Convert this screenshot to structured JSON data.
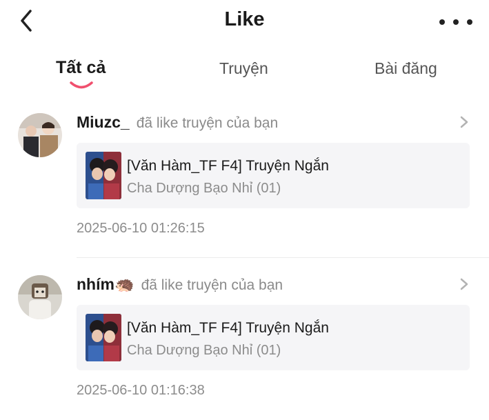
{
  "header": {
    "title": "Like",
    "back_icon": "chevron-left-icon",
    "more_icon": "more-horizontal-icon"
  },
  "tabs": [
    {
      "label": "Tất cả",
      "active": true
    },
    {
      "label": "Truyện",
      "active": false
    },
    {
      "label": "Bài đăng",
      "active": false
    }
  ],
  "colors": {
    "accent": "#f0506e",
    "card_bg": "#f5f5f7",
    "muted_text": "#8c8c8c"
  },
  "notifications": [
    {
      "username": "Miuzc_",
      "action": "đã like truyện của bạn",
      "story_title": "[Văn Hàm_TF F4] Truyện Ngắn",
      "chapter": "Cha Dượng Bạo Nhỉ (01)",
      "time": "2025-06-10 01:26:15"
    },
    {
      "username": "nhím🦔",
      "action": "đã like truyện của bạn",
      "story_title": "[Văn Hàm_TF F4] Truyện Ngắn",
      "chapter": "Cha Dượng Bạo Nhỉ (01)",
      "time": "2025-06-10 01:16:38"
    }
  ]
}
